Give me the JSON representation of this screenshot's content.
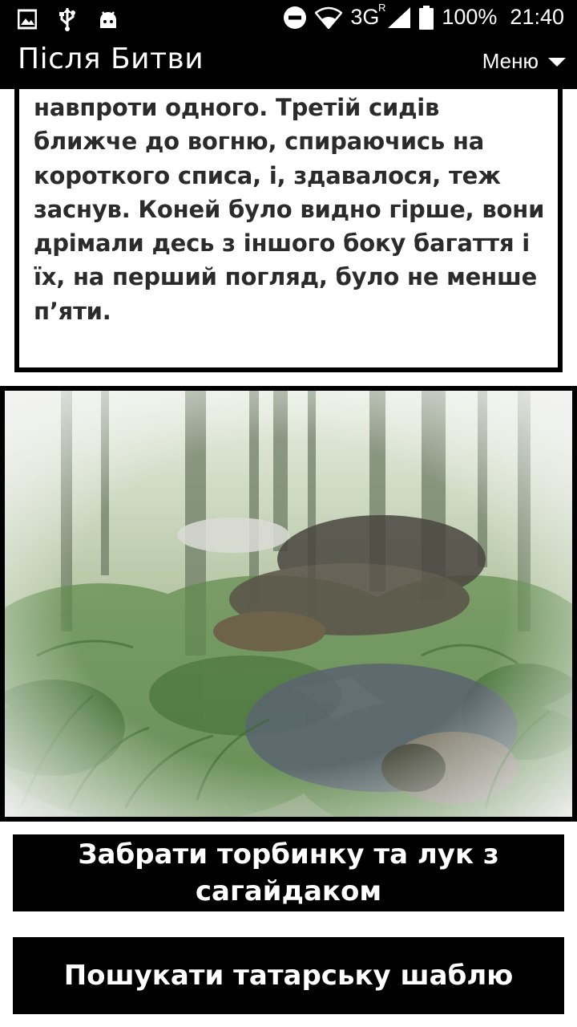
{
  "status_bar": {
    "network": "3G",
    "roaming": "R",
    "battery": "100%",
    "time": "21:40",
    "icons": [
      "image-icon",
      "usb-icon",
      "android-icon",
      "do-not-disturb-icon",
      "wifi-icon",
      "signal-icon",
      "battery-icon"
    ]
  },
  "app_bar": {
    "title": "Після Битви",
    "menu_label": "Меню"
  },
  "story": {
    "text": "навпроти одного. Третій сидів ближче до вогню, спираючись на короткого списа, і, здавалося, теж заснув. Коней було видно гірше, вони дрімали десь з іншого боку багаття і їх, на перший погляд, було не менше п’яти."
  },
  "choices": [
    {
      "label": "Забрати торбинку та лук з сагайдаком"
    },
    {
      "label": "Пошукати татарську шаблю"
    }
  ],
  "colors": {
    "bar_background": "#000000",
    "page_background": "#ffffff",
    "story_text": "#2b2b2b",
    "button_text": "#ffffff"
  }
}
